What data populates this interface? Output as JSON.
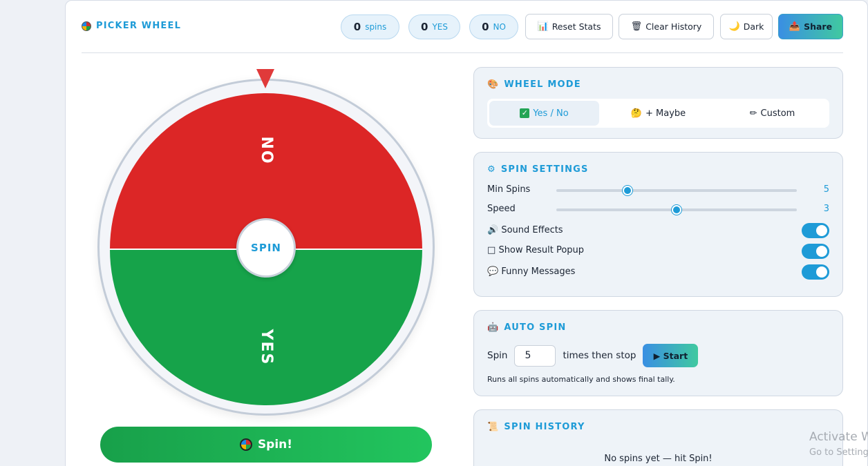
{
  "brand": {
    "title": "PICKER WHEEL",
    "icon": "wheel-icon"
  },
  "stats": {
    "spins_count": "0",
    "spins_label": "spins",
    "yes_count": "0",
    "yes_label": "YES",
    "no_count": "0",
    "no_label": "NO"
  },
  "toolbar": {
    "reset_label": "Reset Stats",
    "reset_icon": "📊",
    "clear_label": "Clear History",
    "clear_icon": "🗑",
    "dark_label": "Dark",
    "dark_icon": "🌙",
    "share_label": "Share",
    "share_icon": "📤"
  },
  "wheel": {
    "segments": [
      {
        "label": "NO",
        "color": "#dc2626"
      },
      {
        "label": "YES",
        "color": "#16a34a"
      }
    ],
    "center_label": "SPIN",
    "pointer_color": "#e03a3a"
  },
  "spin_button": {
    "label": "Spin!"
  },
  "wheel_mode": {
    "title": "WHEEL MODE",
    "icon": "🎨",
    "modes": [
      {
        "label": "Yes / No",
        "icon": "✓",
        "active": true
      },
      {
        "label": "+ Maybe",
        "icon": "🤔",
        "active": false
      },
      {
        "label": "Custom",
        "icon": "✏",
        "active": false
      }
    ]
  },
  "spin_settings": {
    "title": "SPIN SETTINGS",
    "icon": "⚙",
    "min_spins": {
      "label": "Min Spins",
      "value": "5",
      "fraction": 0.3
    },
    "speed": {
      "label": "Speed",
      "value": "3",
      "fraction": 0.5
    },
    "toggles": [
      {
        "label": "Sound Effects",
        "icon": "🔊",
        "on": true
      },
      {
        "label": "Show Result Popup",
        "icon": "□",
        "on": true
      },
      {
        "label": "Funny Messages",
        "icon": "💬",
        "on": true
      }
    ]
  },
  "auto_spin": {
    "title": "AUTO SPIN",
    "icon": "🤖",
    "prefix": "Spin",
    "count": "5",
    "suffix": "times then stop",
    "start_label": "▶ Start",
    "hint": "Runs all spins automatically and shows final tally."
  },
  "history": {
    "title": "SPIN HISTORY",
    "icon": "📜",
    "empty_text": "No spins yet — hit Spin!"
  },
  "watermark": {
    "line1": "Activate W",
    "line2": "Go to Setting"
  }
}
